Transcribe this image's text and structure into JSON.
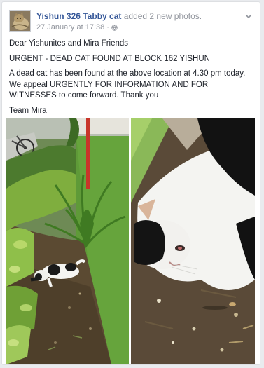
{
  "post": {
    "author": "Yishun 326 Tabby cat",
    "action": "added 2 new photos.",
    "timestamp": "27 January at 17:38",
    "visibility_icon": "globe-icon",
    "menu_icon": "chevron-down-icon",
    "paragraphs": [
      "Dear Yishunites and Mira Friends",
      "URGENT - DEAD CAT FOUND AT BLOCK 162 YISHUN",
      "A dead cat has been found at the above location at 4.30 pm today. We appeal URGENTLY FOR INFORMATION AND FOR WITNESSES to come forward. Thank you",
      "Team Mira"
    ]
  },
  "colors": {
    "link": "#365899",
    "meta": "#90949c",
    "text": "#1d2129",
    "background": "#e9ebee"
  }
}
